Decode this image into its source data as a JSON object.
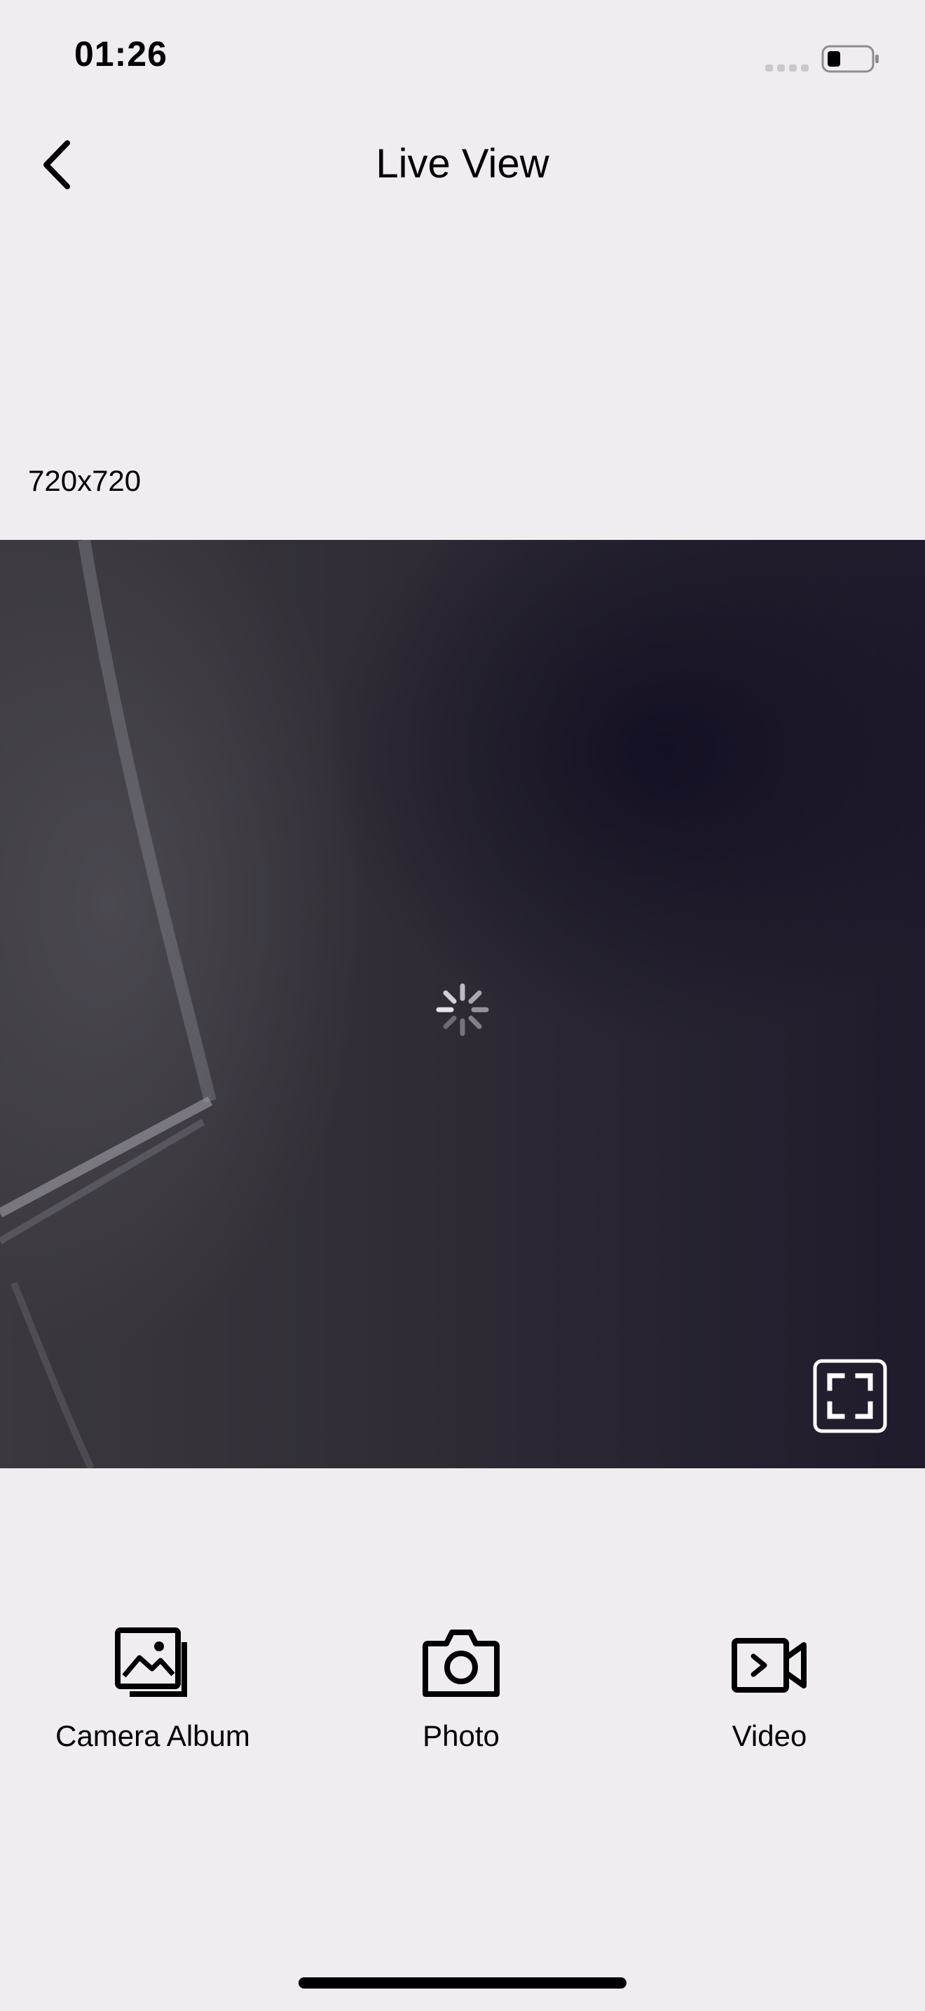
{
  "status_bar": {
    "time": "01:26"
  },
  "nav": {
    "title": "Live View"
  },
  "stream": {
    "resolution": "720x720"
  },
  "actions": [
    {
      "label": "Camera Album",
      "icon": "album-icon"
    },
    {
      "label": "Photo",
      "icon": "camera-icon"
    },
    {
      "label": "Video",
      "icon": "video-icon"
    }
  ],
  "icons": {
    "back": "chevron-left-icon",
    "fullscreen": "fullscreen-icon",
    "loading": "spinner-icon",
    "signal": "signal-icon",
    "battery": "battery-icon"
  }
}
